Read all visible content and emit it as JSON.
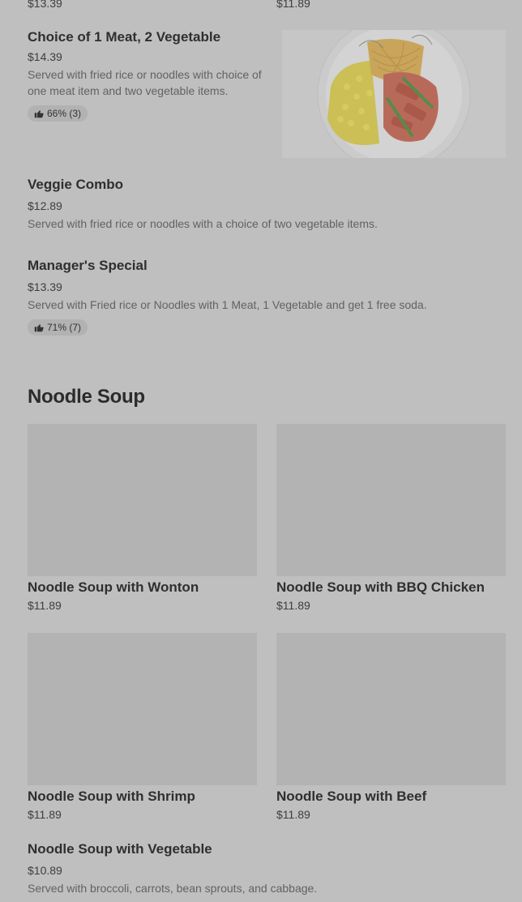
{
  "top_prices": {
    "left": "$13.39",
    "right": "$11.89"
  },
  "combo": {
    "title": "Choice of 1 Meat, 2 Vegetable",
    "price": "$14.39",
    "desc": "Served with fried rice or noodles with choice of one meat item and two vegetable items.",
    "rating": "66% (3)"
  },
  "veggie": {
    "title": "Veggie Combo",
    "price": "$12.89",
    "desc": "Served with fried rice or noodles with a choice of two vegetable items."
  },
  "manager": {
    "title": "Manager's Special",
    "price": "$13.39",
    "desc": "Served with Fried rice or Noodles with 1 Meat, 1 Vegetable and get 1 free soda.",
    "rating": "71% (7)"
  },
  "section": {
    "title": "Noodle Soup"
  },
  "cards": [
    {
      "title": "Noodle Soup with Wonton",
      "price": "$11.89"
    },
    {
      "title": "Noodle Soup with BBQ Chicken",
      "price": "$11.89"
    },
    {
      "title": "Noodle Soup with Shrimp",
      "price": "$11.89"
    },
    {
      "title": "Noodle Soup with Beef",
      "price": "$11.89"
    }
  ],
  "vegetable": {
    "title": "Noodle Soup with Vegetable",
    "price": "$10.89",
    "desc": "Served with broccoli, carrots, bean sprouts, and cabbage."
  },
  "icons": {
    "rating": "thumbs-up-icon"
  }
}
